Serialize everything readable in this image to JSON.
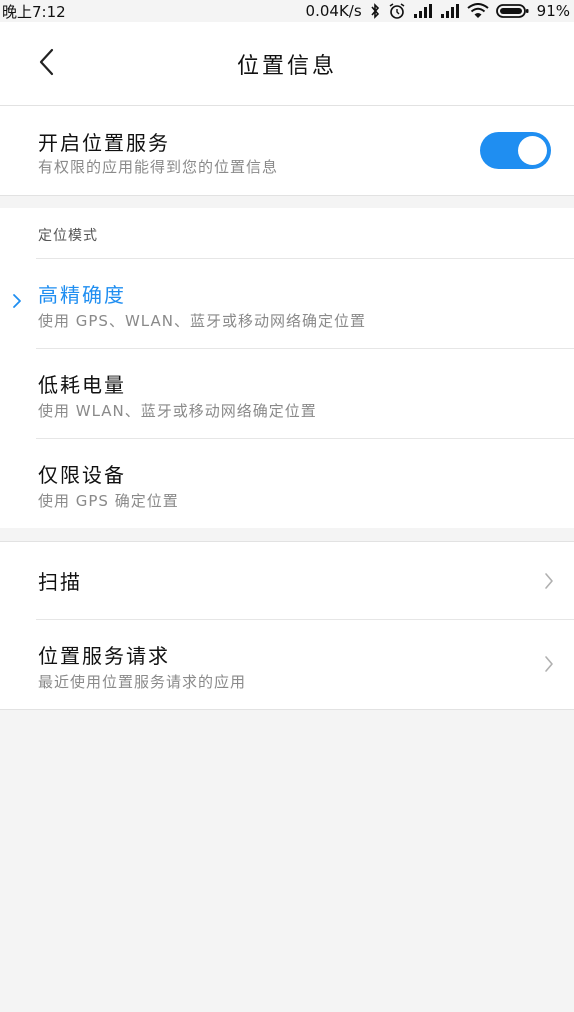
{
  "status_bar": {
    "time": "晚上7:12",
    "network_speed": "0.04K/s",
    "battery": "91%",
    "icons": [
      "bluetooth-icon",
      "alarm-icon",
      "signal-icon",
      "signal-icon",
      "wifi-icon",
      "battery-icon"
    ]
  },
  "header": {
    "title": "位置信息",
    "back_icon": "chevron-left-icon"
  },
  "location_service": {
    "title": "开启位置服务",
    "subtitle": "有权限的应用能得到您的位置信息",
    "enabled": true
  },
  "mode_section": {
    "label": "定位模式",
    "selected_index": 0,
    "options": [
      {
        "title": "高精确度",
        "subtitle": "使用 GPS、WLAN、蓝牙或移动网络确定位置"
      },
      {
        "title": "低耗电量",
        "subtitle": "使用 WLAN、蓝牙或移动网络确定位置"
      },
      {
        "title": "仅限设备",
        "subtitle": "使用 GPS 确定位置"
      }
    ]
  },
  "other_section": {
    "scan": {
      "title": "扫描"
    },
    "requests": {
      "title": "位置服务请求",
      "subtitle": "最近使用位置服务请求的应用"
    }
  },
  "colors": {
    "accent": "#1f8ef1",
    "background": "#f4f4f4",
    "card": "#ffffff",
    "secondary_text": "#8a8a8a"
  }
}
